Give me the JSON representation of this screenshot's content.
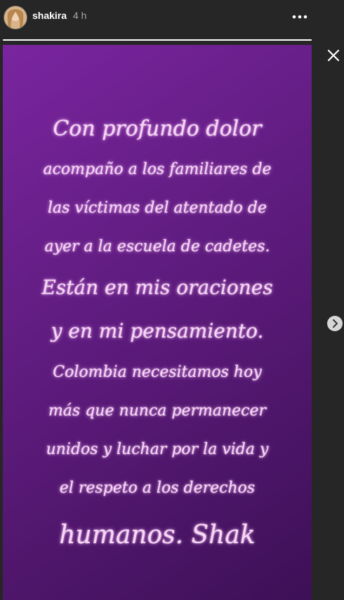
{
  "header": {
    "username": "shakira",
    "timestamp": "4 h"
  },
  "progress": {
    "fraction": 1.0
  },
  "story": {
    "lines": [
      "Con profundo dolor",
      "acompaño a los familiares de",
      "las víctimas del atentado de",
      "ayer a la escuela de cadetes.",
      "Están en mis oraciones",
      "y en mi pensamiento.",
      "Colombia necesitamos hoy",
      "más que nunca permanecer",
      "unidos y luchar por la vida y",
      "el respeto a los derechos",
      "humanos. Shak"
    ],
    "background_colors": [
      "#7a259f",
      "#3d1056"
    ],
    "text_color": "#f4d8f4"
  },
  "icons": {
    "more": "more-horizontal-icon",
    "close": "close-icon",
    "next": "chevron-right-icon"
  }
}
